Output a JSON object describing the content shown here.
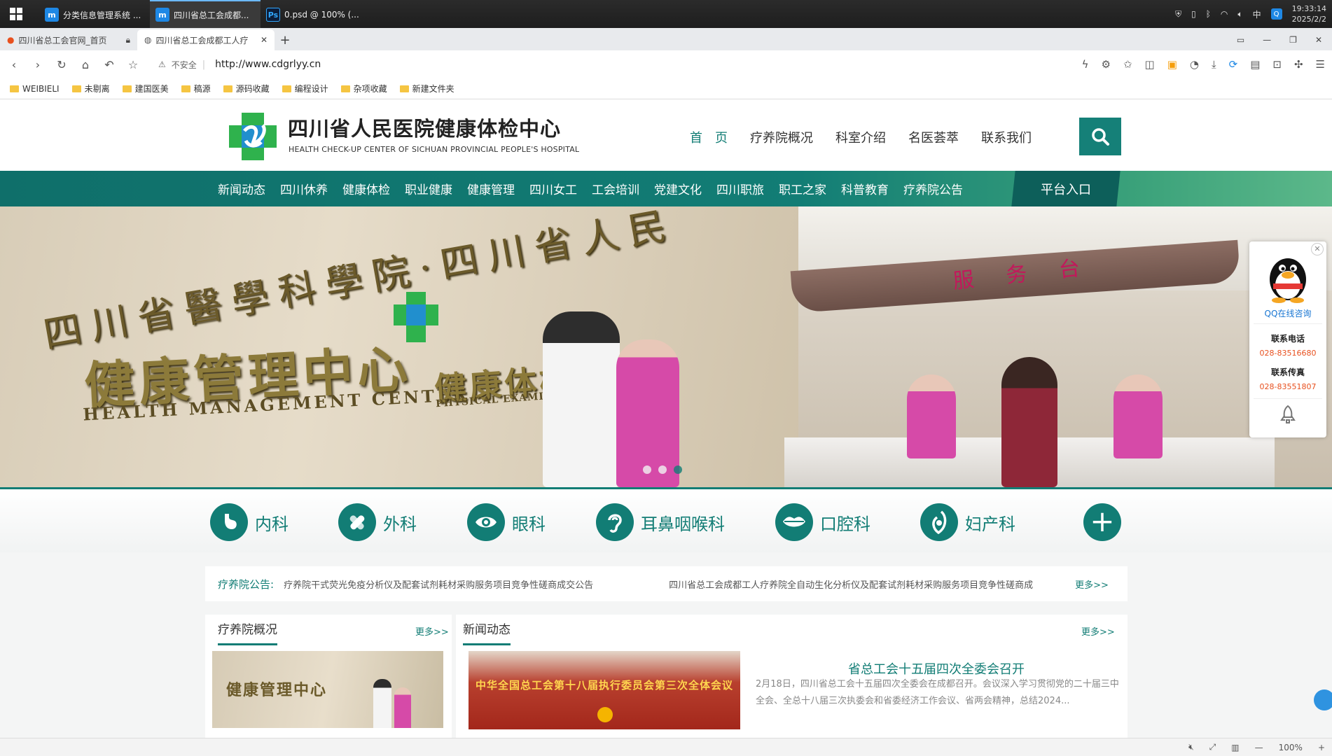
{
  "taskbar": {
    "apps": [
      {
        "icon": "m",
        "label": "分类信息管理系统 ...",
        "color": "#1e88e5",
        "active": false
      },
      {
        "icon": "m",
        "label": "四川省总工会成都...",
        "color": "#1e88e5",
        "active": true
      },
      {
        "icon": "Ps",
        "label": "0.psd @ 100% (...",
        "color": "#0b1d3a",
        "active": false
      }
    ],
    "tray": {
      "ime": "中",
      "time": "19:33:14",
      "date": "2025/2/2"
    }
  },
  "browser": {
    "tabs": [
      {
        "label": "四川省总工会官网_首页",
        "active": false
      },
      {
        "label": "四川省总工会成都工人疗",
        "active": true
      }
    ],
    "insecure_label": "不安全",
    "url": "http://www.cdgrlyy.cn",
    "bookmarks": [
      "WEIBIELI",
      "未剔离",
      "建国医美",
      "稿源",
      "源码收藏",
      "编程设计",
      "杂项收藏",
      "新建文件夹"
    ],
    "zoom": "100%"
  },
  "site": {
    "title": "四川省人民医院健康体检中心",
    "subtitle": "HEALTH CHECK-UP CENTER OF SICHUAN PROVINCIAL PEOPLE'S HOSPITAL",
    "topnav": [
      "首　页",
      "疗养院概况",
      "科室介绍",
      "名医荟萃",
      "联系我们"
    ],
    "mainnav": [
      "新闻动态",
      "四川休养",
      "健康体检",
      "职业健康",
      "健康管理",
      "四川女工",
      "工会培训",
      "党建文化",
      "四川职旅",
      "职工之家",
      "科普教育",
      "疗养院公告"
    ],
    "platform": "平台入口"
  },
  "banner": {
    "wall_line1": "四川省醫學科學院·四川省人民",
    "wall_line2": "健康管理中心",
    "wall_line3": "HEALTH MANAGEMENT CENTER",
    "wall_line4": "健康体检",
    "wall_line5": "PHYSICAL EXAMINA",
    "service_desk": "服务台",
    "slide_count": 3,
    "active_slide": 3
  },
  "qq": {
    "label": "QQ在线咨询",
    "phone_label": "联系电话",
    "phone": "028-83516680",
    "fax_label": "联系传真",
    "fax": "028-83551807"
  },
  "specialties": [
    {
      "label": "内科",
      "icon": "stomach-icon"
    },
    {
      "label": "外科",
      "icon": "bandage-icon"
    },
    {
      "label": "眼科",
      "icon": "eye-icon"
    },
    {
      "label": "耳鼻咽喉科",
      "icon": "ear-icon"
    },
    {
      "label": "口腔科",
      "icon": "lips-icon"
    },
    {
      "label": "妇产科",
      "icon": "womb-icon"
    }
  ],
  "notice": {
    "label": "疗养院公告:",
    "items": [
      "疗养院干式荧光免疫分析仪及配套试剂耗材采购服务项目竞争性磋商成交公告",
      "四川省总工会成都工人疗养院全自动生化分析仪及配套试剂耗材采购服务项目竞争性磋商成"
    ],
    "more": "更多>>"
  },
  "panels": {
    "overview": {
      "title": "疗养院概况",
      "more": "更多>>"
    },
    "news": {
      "title": "新闻动态",
      "more": "更多>>",
      "headline": "省总工会十五届四次全委会召开",
      "summary": "2月18日，四川省总工会十五届四次全委会在成都召开。会议深入学习贯彻党的二十届三中全会、全总十八届三次执委会和省委经济工作会议、省两会精神，总结2024...",
      "image_caption": "中华全国总工会第十八届执行委员会第三次全体会议"
    }
  }
}
